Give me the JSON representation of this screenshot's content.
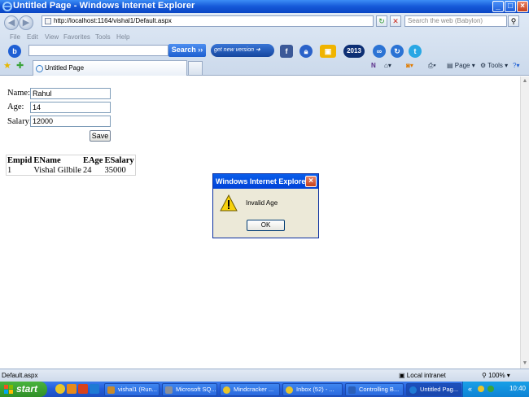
{
  "window": {
    "title": "Untitled Page - Windows Internet Explorer"
  },
  "address_bar": {
    "url": "http://localhost:1164/vishal1/Default.aspx"
  },
  "web_search": {
    "placeholder": "Search the web (Babylon)"
  },
  "menu": [
    "File",
    "Edit",
    "View",
    "Favorites",
    "Tools",
    "Help"
  ],
  "toolbar": {
    "search_label": "Search",
    "new_version_label": "get new version",
    "year_badge": "2013"
  },
  "tab": {
    "title": "Untitled Page"
  },
  "command_bar": {
    "page_label": "Page",
    "tools_label": "Tools"
  },
  "form": {
    "name_label": "Name:",
    "name_value": "Rahul",
    "age_label": "Age:",
    "age_value": "14",
    "salary_label": "Salary:",
    "salary_value": "12000",
    "save_label": "Save"
  },
  "grid": {
    "headers": [
      "Empid",
      "EName",
      "EAge",
      "ESalary"
    ],
    "rows": [
      [
        "1",
        "Vishal Gilbile",
        "24",
        "35000"
      ]
    ]
  },
  "dialog": {
    "title": "Windows Internet Explorer",
    "message": "Invalid Age",
    "ok_label": "OK"
  },
  "status_bar": {
    "text": "Default.aspx",
    "zone": "Local intranet",
    "zoom": "100%"
  },
  "taskbar": {
    "start_label": "start",
    "tasks": [
      "vishal1 (Run...",
      "Microsoft SQ...",
      "Mindcracker ...",
      "Inbox (52) - ...",
      "Controlling B...",
      "Untitled Pag..."
    ],
    "clock": "10:40"
  },
  "colors": {
    "title_blue": "#1558d8",
    "dialog_title_blue": "#0a5dea",
    "start_green": "#3a9f30"
  }
}
